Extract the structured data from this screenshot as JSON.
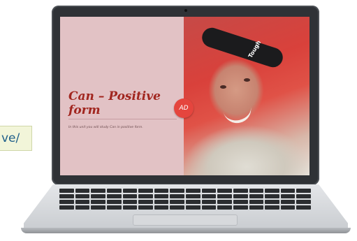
{
  "side_label": {
    "text": "ve/"
  },
  "slide": {
    "title": "Can – Positive form",
    "subtitle": "In this unit you will study Can in positive form.",
    "badge": "AD",
    "headband_text": "Tough"
  },
  "colors": {
    "slide_background": "#e2c2c5",
    "title_color": "#a1261f",
    "badge_color": "#e5453e",
    "side_label_background": "#f2f5d9",
    "side_label_text": "#1f5f8a"
  },
  "icons": {
    "camera": "webcam-icon"
  }
}
